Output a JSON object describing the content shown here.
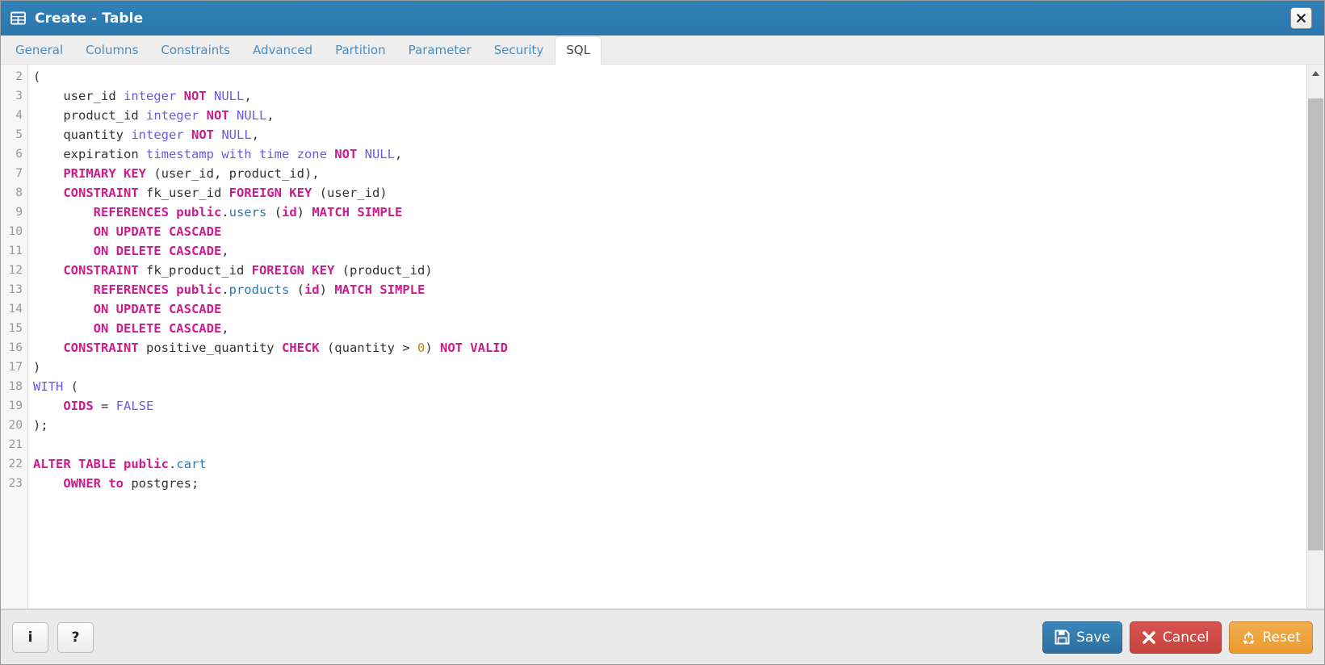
{
  "window": {
    "title": "Create - Table",
    "icon": "table-icon",
    "close_label": "✕"
  },
  "tabs": [
    {
      "label": "General",
      "active": false
    },
    {
      "label": "Columns",
      "active": false
    },
    {
      "label": "Constraints",
      "active": false
    },
    {
      "label": "Advanced",
      "active": false
    },
    {
      "label": "Partition",
      "active": false
    },
    {
      "label": "Parameter",
      "active": false
    },
    {
      "label": "Security",
      "active": false
    },
    {
      "label": "SQL",
      "active": true
    }
  ],
  "editor": {
    "first_line_number": 2,
    "lines": [
      {
        "n": 2,
        "tokens": [
          {
            "t": "(",
            "c": "p"
          }
        ]
      },
      {
        "n": 3,
        "tokens": [
          {
            "t": "    user_id ",
            "c": "id"
          },
          {
            "t": "integer",
            "c": "kw2"
          },
          {
            "t": " ",
            "c": "id"
          },
          {
            "t": "NOT",
            "c": "kw"
          },
          {
            "t": " ",
            "c": "id"
          },
          {
            "t": "NULL",
            "c": "kw2"
          },
          {
            "t": ",",
            "c": "p"
          }
        ]
      },
      {
        "n": 4,
        "tokens": [
          {
            "t": "    product_id ",
            "c": "id"
          },
          {
            "t": "integer",
            "c": "kw2"
          },
          {
            "t": " ",
            "c": "id"
          },
          {
            "t": "NOT",
            "c": "kw"
          },
          {
            "t": " ",
            "c": "id"
          },
          {
            "t": "NULL",
            "c": "kw2"
          },
          {
            "t": ",",
            "c": "p"
          }
        ]
      },
      {
        "n": 5,
        "tokens": [
          {
            "t": "    quantity ",
            "c": "id"
          },
          {
            "t": "integer",
            "c": "kw2"
          },
          {
            "t": " ",
            "c": "id"
          },
          {
            "t": "NOT",
            "c": "kw"
          },
          {
            "t": " ",
            "c": "id"
          },
          {
            "t": "NULL",
            "c": "kw2"
          },
          {
            "t": ",",
            "c": "p"
          }
        ]
      },
      {
        "n": 6,
        "tokens": [
          {
            "t": "    expiration ",
            "c": "id"
          },
          {
            "t": "timestamp with time zone",
            "c": "kw2"
          },
          {
            "t": " ",
            "c": "id"
          },
          {
            "t": "NOT",
            "c": "kw"
          },
          {
            "t": " ",
            "c": "id"
          },
          {
            "t": "NULL",
            "c": "kw2"
          },
          {
            "t": ",",
            "c": "p"
          }
        ]
      },
      {
        "n": 7,
        "tokens": [
          {
            "t": "    ",
            "c": "id"
          },
          {
            "t": "PRIMARY KEY",
            "c": "kw"
          },
          {
            "t": " (user_id, product_id),",
            "c": "id"
          }
        ]
      },
      {
        "n": 8,
        "tokens": [
          {
            "t": "    ",
            "c": "id"
          },
          {
            "t": "CONSTRAINT",
            "c": "kw"
          },
          {
            "t": " fk_user_id ",
            "c": "id"
          },
          {
            "t": "FOREIGN KEY",
            "c": "kw"
          },
          {
            "t": " (user_id)",
            "c": "id"
          }
        ]
      },
      {
        "n": 9,
        "tokens": [
          {
            "t": "        ",
            "c": "id"
          },
          {
            "t": "REFERENCES public",
            "c": "kw"
          },
          {
            "t": ".",
            "c": "p"
          },
          {
            "t": "users",
            "c": "tbl"
          },
          {
            "t": " (",
            "c": "id"
          },
          {
            "t": "id",
            "c": "kw"
          },
          {
            "t": ") ",
            "c": "id"
          },
          {
            "t": "MATCH SIMPLE",
            "c": "kw"
          }
        ]
      },
      {
        "n": 10,
        "tokens": [
          {
            "t": "        ",
            "c": "id"
          },
          {
            "t": "ON UPDATE CASCADE",
            "c": "kw"
          }
        ]
      },
      {
        "n": 11,
        "tokens": [
          {
            "t": "        ",
            "c": "id"
          },
          {
            "t": "ON DELETE CASCADE",
            "c": "kw"
          },
          {
            "t": ",",
            "c": "p"
          }
        ]
      },
      {
        "n": 12,
        "tokens": [
          {
            "t": "    ",
            "c": "id"
          },
          {
            "t": "CONSTRAINT",
            "c": "kw"
          },
          {
            "t": " fk_product_id ",
            "c": "id"
          },
          {
            "t": "FOREIGN KEY",
            "c": "kw"
          },
          {
            "t": " (product_id)",
            "c": "id"
          }
        ]
      },
      {
        "n": 13,
        "tokens": [
          {
            "t": "        ",
            "c": "id"
          },
          {
            "t": "REFERENCES public",
            "c": "kw"
          },
          {
            "t": ".",
            "c": "p"
          },
          {
            "t": "products",
            "c": "tbl"
          },
          {
            "t": " (",
            "c": "id"
          },
          {
            "t": "id",
            "c": "kw"
          },
          {
            "t": ") ",
            "c": "id"
          },
          {
            "t": "MATCH SIMPLE",
            "c": "kw"
          }
        ]
      },
      {
        "n": 14,
        "tokens": [
          {
            "t": "        ",
            "c": "id"
          },
          {
            "t": "ON UPDATE CASCADE",
            "c": "kw"
          }
        ]
      },
      {
        "n": 15,
        "tokens": [
          {
            "t": "        ",
            "c": "id"
          },
          {
            "t": "ON DELETE CASCADE",
            "c": "kw"
          },
          {
            "t": ",",
            "c": "p"
          }
        ]
      },
      {
        "n": 16,
        "tokens": [
          {
            "t": "    ",
            "c": "id"
          },
          {
            "t": "CONSTRAINT",
            "c": "kw"
          },
          {
            "t": " positive_quantity ",
            "c": "id"
          },
          {
            "t": "CHECK",
            "c": "kw"
          },
          {
            "t": " (quantity > ",
            "c": "id"
          },
          {
            "t": "0",
            "c": "num"
          },
          {
            "t": ") ",
            "c": "id"
          },
          {
            "t": "NOT VALID",
            "c": "kw"
          }
        ]
      },
      {
        "n": 17,
        "tokens": [
          {
            "t": ")",
            "c": "p"
          }
        ]
      },
      {
        "n": 18,
        "tokens": [
          {
            "t": "WITH",
            "c": "kw2"
          },
          {
            "t": " (",
            "c": "id"
          }
        ]
      },
      {
        "n": 19,
        "tokens": [
          {
            "t": "    ",
            "c": "id"
          },
          {
            "t": "OIDS",
            "c": "kw"
          },
          {
            "t": " = ",
            "c": "id"
          },
          {
            "t": "FALSE",
            "c": "kw2"
          }
        ]
      },
      {
        "n": 20,
        "tokens": [
          {
            "t": ");",
            "c": "p"
          }
        ]
      },
      {
        "n": 21,
        "tokens": [
          {
            "t": "",
            "c": "p"
          }
        ]
      },
      {
        "n": 22,
        "tokens": [
          {
            "t": "ALTER TABLE public",
            "c": "kw"
          },
          {
            "t": ".",
            "c": "p"
          },
          {
            "t": "cart",
            "c": "tbl"
          }
        ]
      },
      {
        "n": 23,
        "tokens": [
          {
            "t": "    ",
            "c": "id"
          },
          {
            "t": "OWNER to",
            "c": "kw"
          },
          {
            "t": " postgres;",
            "c": "id"
          }
        ]
      }
    ],
    "plain_sql": "(\n    user_id integer NOT NULL,\n    product_id integer NOT NULL,\n    quantity integer NOT NULL,\n    expiration timestamp with time zone NOT NULL,\n    PRIMARY KEY (user_id, product_id),\n    CONSTRAINT fk_user_id FOREIGN KEY (user_id)\n        REFERENCES public.users (id) MATCH SIMPLE\n        ON UPDATE CASCADE\n        ON DELETE CASCADE,\n    CONSTRAINT fk_product_id FOREIGN KEY (product_id)\n        REFERENCES public.products (id) MATCH SIMPLE\n        ON UPDATE CASCADE\n        ON DELETE CASCADE,\n    CONSTRAINT positive_quantity CHECK (quantity > 0) NOT VALID\n)\nWITH (\n    OIDS = FALSE\n);\n\nALTER TABLE public.cart\n    OWNER to postgres;"
  },
  "scrollbar": {
    "up_arrow": "chevron-up-icon"
  },
  "footer": {
    "info_label": "i",
    "help_label": "?",
    "save_label": "Save",
    "cancel_label": "Cancel",
    "reset_label": "Reset"
  },
  "colors": {
    "titlebar": "#2e7cb4",
    "tab_link": "#4b8dc0",
    "keyword": "#cc1a8f",
    "type": "#6b5ce7",
    "table": "#2a7ab0",
    "number": "#b8860b",
    "save": "#3a86bd",
    "cancel": "#d9534f",
    "reset": "#f0ad4e"
  }
}
